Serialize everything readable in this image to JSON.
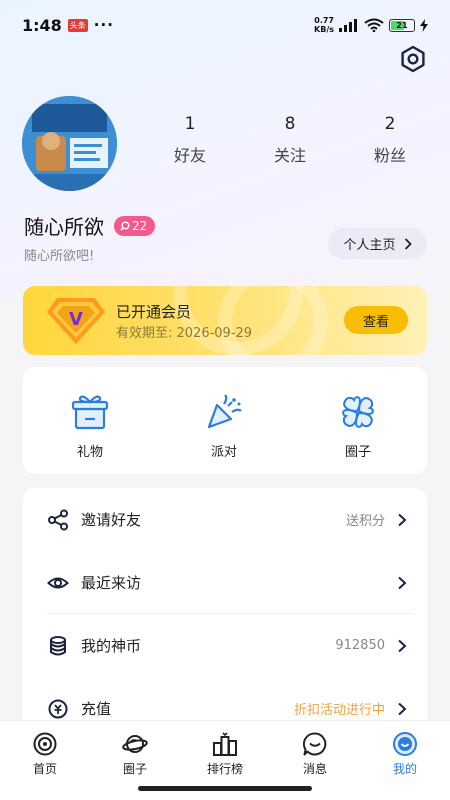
{
  "status_bar": {
    "time": "1:48",
    "app_badge": "头条",
    "dots": "···",
    "net_speed_value": "0.77",
    "net_speed_unit": "KB/s",
    "battery": "21"
  },
  "profile": {
    "stats": [
      {
        "value": "1",
        "label": "好友"
      },
      {
        "value": "8",
        "label": "关注"
      },
      {
        "value": "2",
        "label": "粉丝"
      }
    ],
    "username": "随心所欲",
    "level": "22",
    "bio": "随心所欲吧!",
    "homepage_label": "个人主页"
  },
  "vip": {
    "title": "已开通会员",
    "expiry": "有效期至: 2026-09-29",
    "button": "查看"
  },
  "quick_actions": [
    {
      "label": "礼物",
      "icon": "gift-icon"
    },
    {
      "label": "派对",
      "icon": "party-popper-icon"
    },
    {
      "label": "圈子",
      "icon": "clover-icon"
    }
  ],
  "menu": [
    {
      "label": "邀请好友",
      "value": "送积分",
      "icon": "share-icon"
    },
    {
      "label": "最近来访",
      "value": "",
      "icon": "eye-icon"
    },
    {
      "label": "我的神币",
      "value": "912850",
      "icon": "coins-icon"
    },
    {
      "label": "充值",
      "value": "折扣活动进行中",
      "icon": "recharge-icon"
    }
  ],
  "tabs": [
    {
      "label": "首页",
      "icon": "home-icon"
    },
    {
      "label": "圈子",
      "icon": "planet-icon"
    },
    {
      "label": "排行榜",
      "icon": "leaderboard-icon"
    },
    {
      "label": "消息",
      "icon": "message-icon"
    },
    {
      "label": "我的",
      "icon": "profile-icon",
      "active": true
    }
  ],
  "colors": {
    "accent": "#2a7de1",
    "vip_gold": "#ffd63b",
    "level_badge": "#f25a8b",
    "promo_orange": "#f0a238"
  }
}
